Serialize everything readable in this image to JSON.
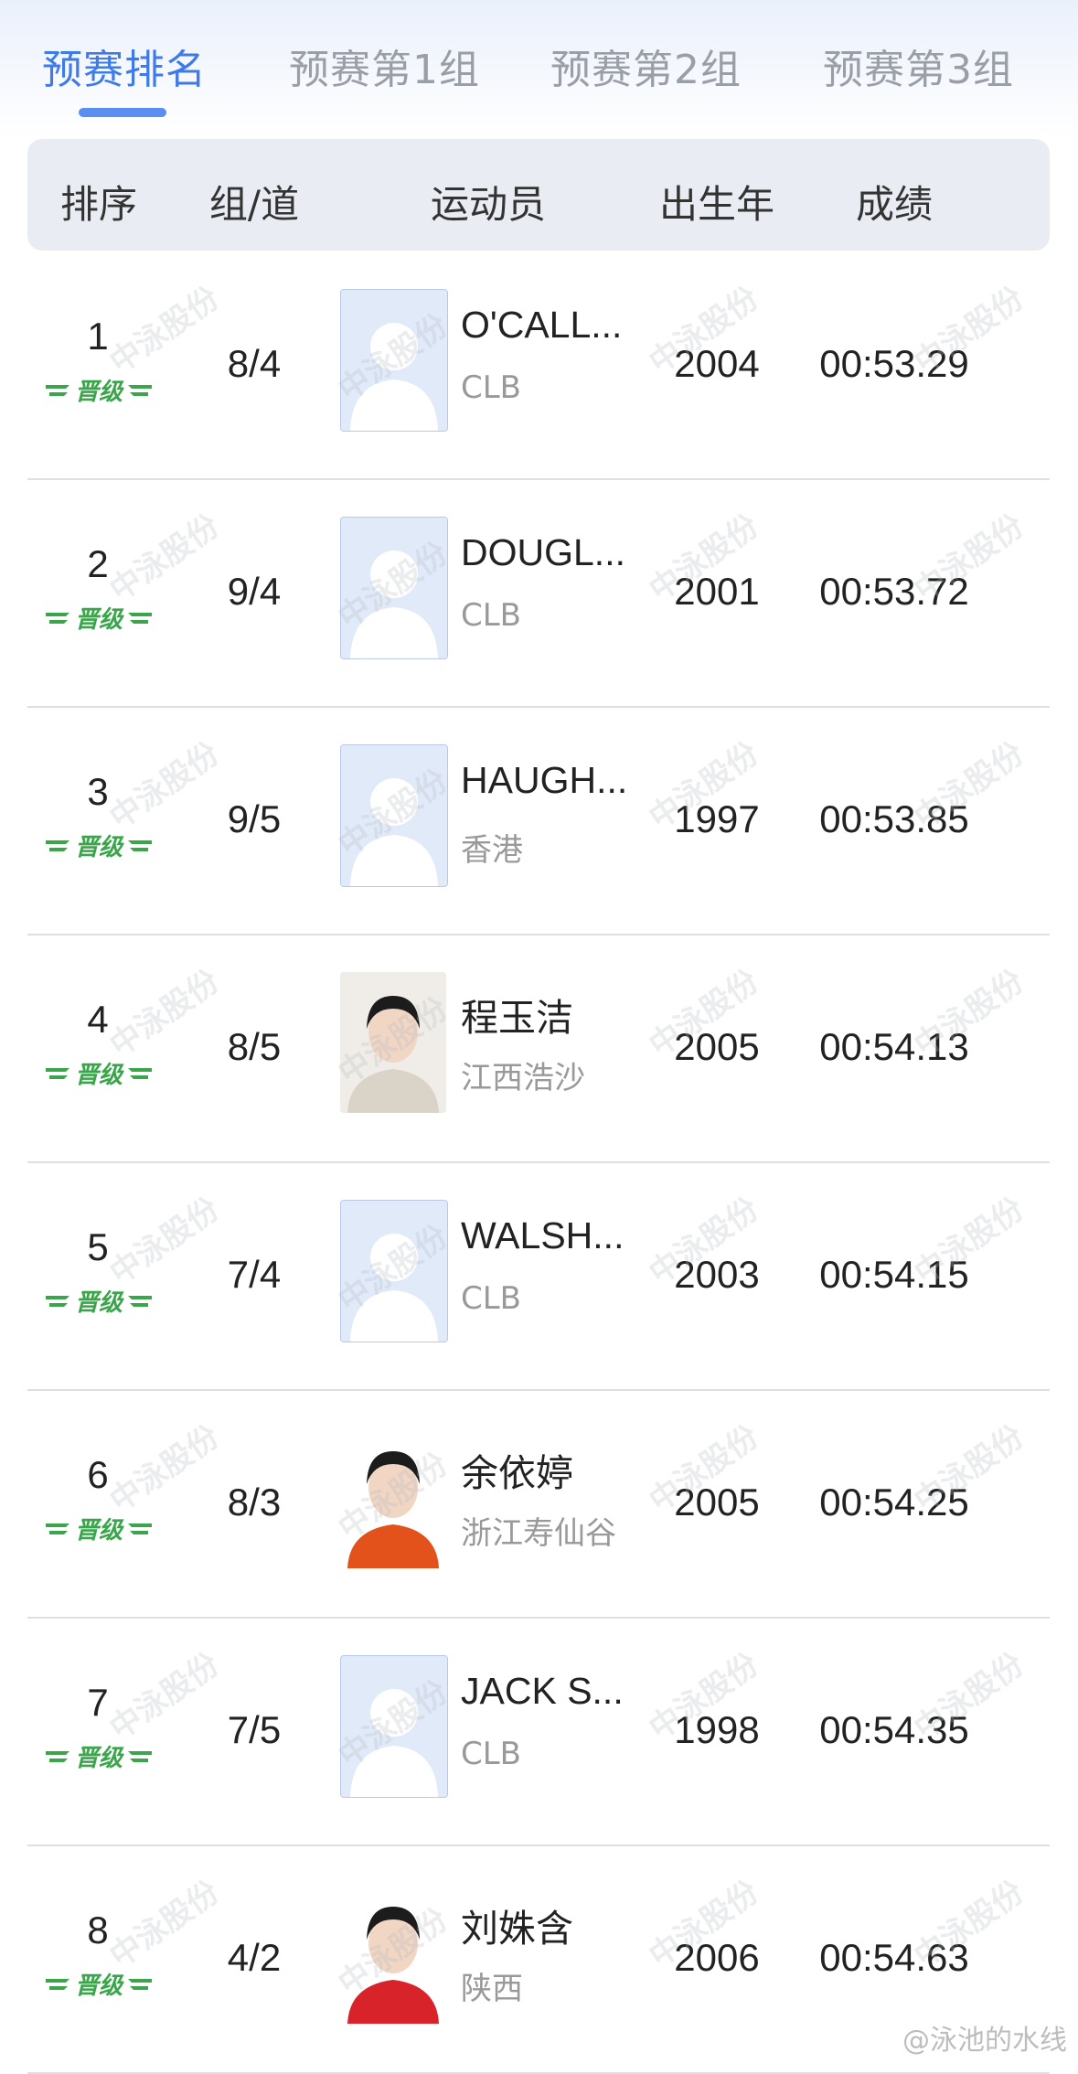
{
  "tabs": [
    {
      "label": "预赛排名",
      "active": true
    },
    {
      "label": "预赛第1组",
      "active": false
    },
    {
      "label": "预赛第2组",
      "active": false
    },
    {
      "label": "预赛第3组",
      "active": false
    }
  ],
  "columns": {
    "rank": "排序",
    "group_lane": "组/道",
    "athlete": "运动员",
    "birth_year": "出生年",
    "result": "成绩"
  },
  "badge_text": "晋级",
  "watermark": "中泳股份",
  "credit": "@泳池的水线",
  "colors": {
    "accent": "#3f7be8",
    "badge_green": "#3aa54a",
    "placeholder_avatar": "#e1eaf9"
  },
  "rows": [
    {
      "rank": "1",
      "group_lane": "8/4",
      "name": "O'CALL...",
      "club": "CLB",
      "year": "2004",
      "time": "00:53.29",
      "photo": "placeholder"
    },
    {
      "rank": "2",
      "group_lane": "9/4",
      "name": "DOUGL...",
      "club": "CLB",
      "year": "2001",
      "time": "00:53.72",
      "photo": "placeholder"
    },
    {
      "rank": "3",
      "group_lane": "9/5",
      "name": "HAUGH...",
      "club": "香港",
      "year": "1997",
      "time": "00:53.85",
      "photo": "placeholder"
    },
    {
      "rank": "4",
      "group_lane": "8/5",
      "name": "程玉洁",
      "club": "江西浩沙",
      "year": "2005",
      "time": "00:54.13",
      "photo": "portrait-gray"
    },
    {
      "rank": "5",
      "group_lane": "7/4",
      "name": "WALSH...",
      "club": "CLB",
      "year": "2003",
      "time": "00:54.15",
      "photo": "placeholder"
    },
    {
      "rank": "6",
      "group_lane": "8/3",
      "name": "余依婷",
      "club": "浙江寿仙谷",
      "year": "2005",
      "time": "00:54.25",
      "photo": "portrait-orange"
    },
    {
      "rank": "7",
      "group_lane": "7/5",
      "name": "JACK S...",
      "club": "CLB",
      "year": "1998",
      "time": "00:54.35",
      "photo": "placeholder"
    },
    {
      "rank": "8",
      "group_lane": "4/2",
      "name": "刘姝含",
      "club": "陕西",
      "year": "2006",
      "time": "00:54.63",
      "photo": "portrait-red"
    }
  ]
}
